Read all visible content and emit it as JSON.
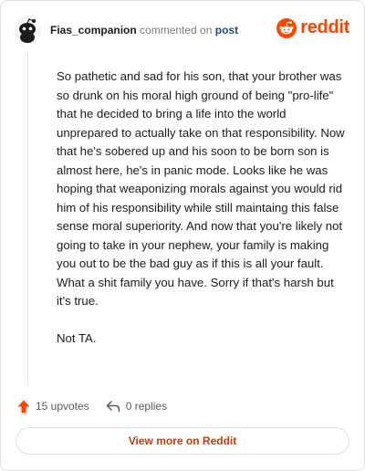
{
  "header": {
    "username": "Fias_companion",
    "commented_text": "commented on",
    "post_link": "post"
  },
  "brand": {
    "wordmark": "reddit",
    "color": "#ff4500"
  },
  "comment": {
    "paragraphs": [
      "So pathetic and sad for his son, that your brother was so drunk on his moral high ground of being \"pro-life\" that he decided to bring a life into the world unprepared to actually take on that responsibility. Now that he's sobered up and his soon to be born son is almost here, he's in panic mode. Looks like he was hoping that weaponizing morals against you would rid him of his responsibility while still maintaing this false sense moral superiority. And now that you're likely not going to take in your nephew, your family is making you out to be the bad guy as if this is all your fault. What a shit family you have. Sorry if that's harsh but it's true.",
      "Not TA."
    ]
  },
  "actions": {
    "upvotes_label": "15 upvotes",
    "upvote_icon": "upvote-arrow-icon",
    "replies_label": "0 replies",
    "reply_icon": "reply-arrow-icon"
  },
  "footer": {
    "view_more_label": "View more on Reddit",
    "accent": "#c43b0c"
  }
}
